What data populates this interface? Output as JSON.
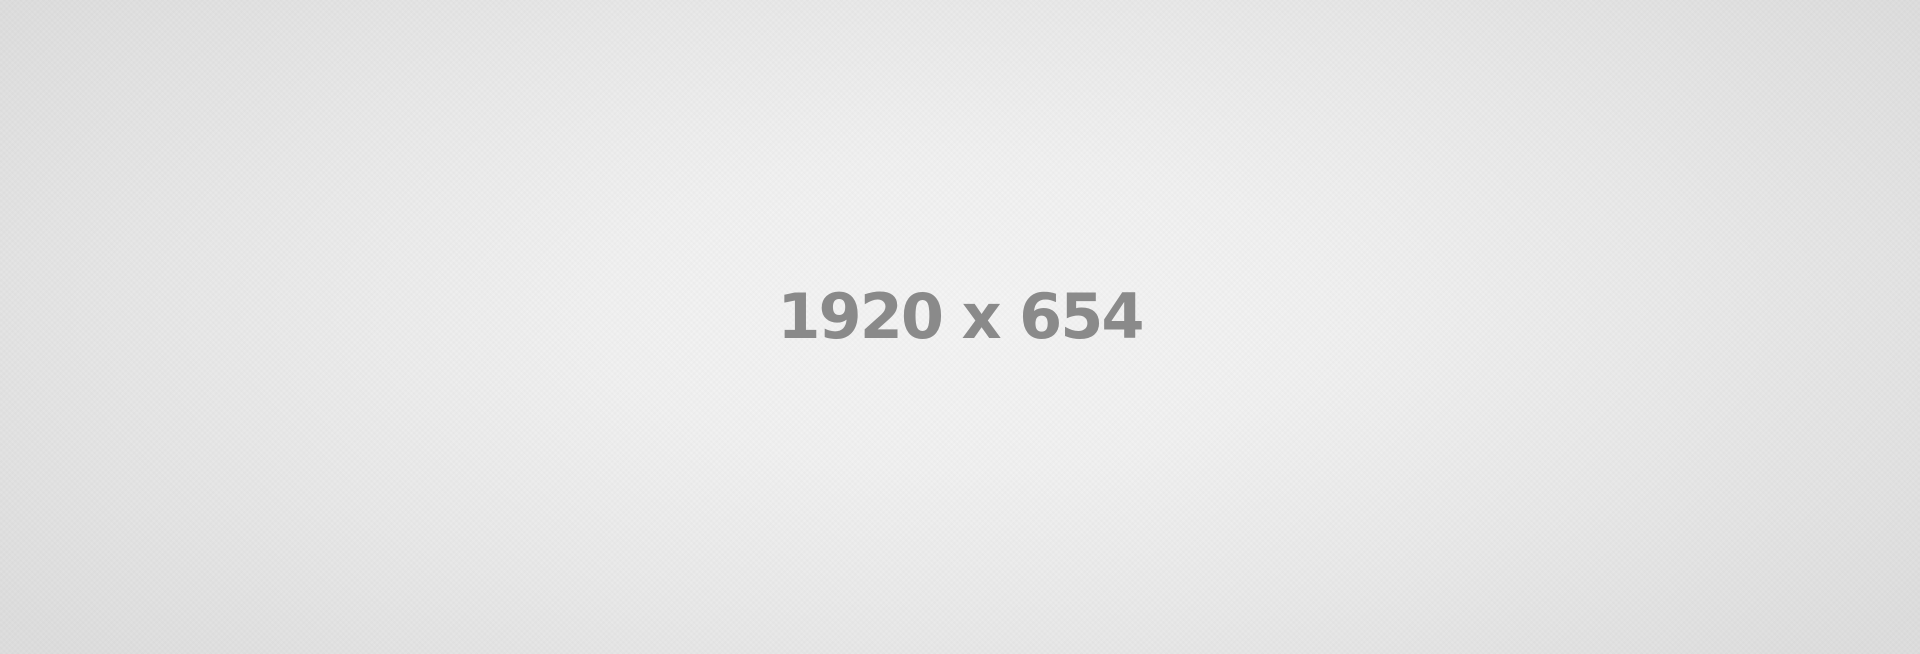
{
  "placeholder": {
    "label": "1920 x 654"
  },
  "colors": {
    "text": "#8a8a8a",
    "background_center": "#f4f4f4",
    "background_edge": "#dedede"
  }
}
